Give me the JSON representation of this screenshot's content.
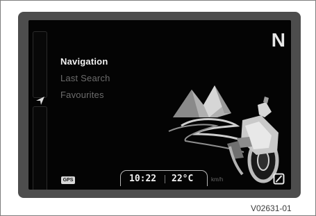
{
  "menu": {
    "items": [
      {
        "label": "Navigation",
        "state": "active"
      },
      {
        "label": "Last Search",
        "state": "inactive"
      },
      {
        "label": "Favourites",
        "state": "inactive"
      }
    ]
  },
  "compass": {
    "label": "N"
  },
  "status": {
    "gps": "GPS",
    "time": "10:22",
    "temperature": "22°C",
    "speed_unit": "km/h"
  },
  "icons": {
    "nav_arrow": "navigation-arrow-icon",
    "mute": "mute-icon"
  },
  "caption": "V02631-01",
  "colors": {
    "screen_bg": "#040404",
    "bezel": "#4d4d4d",
    "active_text": "#f2f2f2",
    "inactive_text": "#6c6c6c"
  }
}
